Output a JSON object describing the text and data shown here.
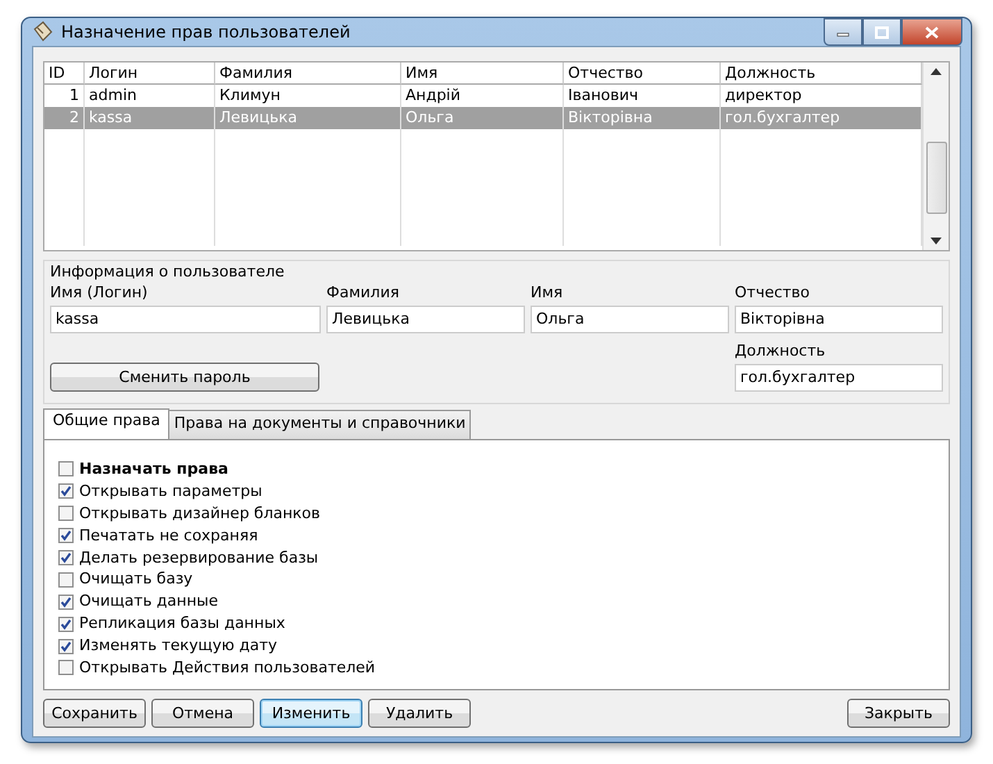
{
  "window": {
    "title": "Назначение прав пользователей"
  },
  "table": {
    "columns": [
      "ID",
      "Логин",
      "Фамилия",
      "Имя",
      "Отчество",
      "Должность"
    ],
    "rows": [
      {
        "cells": [
          "1",
          "admin",
          "Климун",
          "Андрій",
          "Іванович",
          "директор"
        ],
        "selected": false
      },
      {
        "cells": [
          "2",
          "kassa",
          "Левицька",
          "Ольга",
          "Вікторівна",
          "гол.бухгалтер"
        ],
        "selected": true
      }
    ]
  },
  "user_info": {
    "title": "Информация о пользователе",
    "fields": [
      {
        "label": "Имя (Логин)",
        "value": "kassa"
      },
      {
        "label": "Фамилия",
        "value": "Левицька"
      },
      {
        "label": "Имя",
        "value": "Ольга"
      },
      {
        "label": "Отчество",
        "value": "Вікторівна"
      },
      {
        "label": "Должность",
        "value": "гол.бухгалтер"
      }
    ],
    "change_password": "Сменить пароль"
  },
  "tabs": [
    {
      "label": "Общие права",
      "selected": true
    },
    {
      "label": "Права на документы и справочники",
      "selected": false
    }
  ],
  "permissions": [
    {
      "label": "Назначать права",
      "checked": false,
      "kind": "master"
    },
    {
      "label": "Открывать параметры",
      "checked": true,
      "kind": "item"
    },
    {
      "label": "Открывать дизайнер бланков",
      "checked": false,
      "kind": "item"
    },
    {
      "label": "Печатать не сохраняя",
      "checked": true,
      "kind": "item"
    },
    {
      "label": "Делать резервирование базы",
      "checked": true,
      "kind": "item"
    },
    {
      "label": "Очищать базу",
      "checked": false,
      "kind": "item"
    },
    {
      "label": "Очищать данные",
      "checked": true,
      "kind": "item"
    },
    {
      "label": "Репликация базы данных",
      "checked": true,
      "kind": "item"
    },
    {
      "label": "Изменять текущую дату",
      "checked": true,
      "kind": "item"
    },
    {
      "label": "Открывать Действия пользователей",
      "checked": false,
      "kind": "item"
    }
  ],
  "buttons": [
    {
      "label": "Сохранить",
      "default": false
    },
    {
      "label": "Отмена",
      "default": false
    },
    {
      "label": "Изменить",
      "default": true
    },
    {
      "label": "Удалить",
      "default": false
    }
  ],
  "close_button": {
    "label": "Закрыть"
  }
}
